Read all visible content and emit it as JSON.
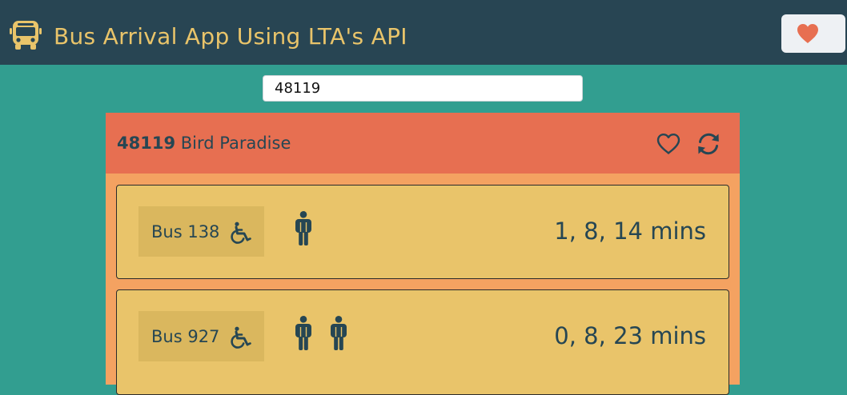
{
  "navbar": {
    "logo_icon": "bus-icon",
    "title": "Bus Arrival App Using LTA's API",
    "favorites_icon": "heart-icon"
  },
  "search": {
    "value": "48119",
    "placeholder": ""
  },
  "stop": {
    "code": "48119",
    "name": "Bird Paradise",
    "favorite_icon": "heart-outline-icon",
    "refresh_icon": "refresh-icon"
  },
  "buses": [
    {
      "label": "Bus 138",
      "wheelchair_icon": "wheelchair-icon",
      "load_icons": 1,
      "eta": "1, 8, 14 mins"
    },
    {
      "label": "Bus 927",
      "wheelchair_icon": "wheelchair-icon",
      "load_icons": 2,
      "eta": "0, 8, 23 mins"
    }
  ],
  "colors": {
    "navbar": "#284553",
    "accent_yellow": "#e9c46a",
    "background": "#329e90",
    "card": "#f4a261",
    "card_header": "#e76f51",
    "heart": "#e76f51",
    "text_dark": "#264653"
  }
}
